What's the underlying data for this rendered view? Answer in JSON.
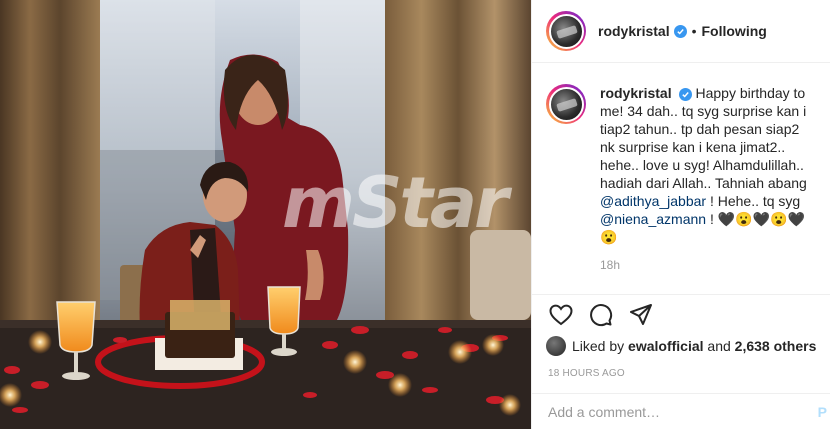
{
  "post": {
    "username": "rodykristal",
    "follow_status": "Following",
    "separator": "•",
    "photo_watermark": "mStar"
  },
  "caption": {
    "username": "rodykristal",
    "text_before_mention1": "Happy birthday to me! 34 dah.. tq syg surprise kan i tiap2 tahun.. tp dah pesan siap2 nk surprise kan i kena jimat2.. hehe.. love u syg! Alhamdulillah.. hadiah dari Allah.. Tahniah abang ",
    "mention1": "@adithya_jabbar",
    "text_between": " ! Hehe.. tq syg ",
    "mention2": "@niena_azmann",
    "text_after": " ! 🖤😮🖤😮🖤😮",
    "time_ago": "18h"
  },
  "actions": {
    "like_icon": "heart-icon",
    "comment_icon": "comment-bubble-icon",
    "share_icon": "paper-plane-icon"
  },
  "likes": {
    "prefix": "Liked by ",
    "user": "ewalofficial",
    "middle": " and ",
    "count": "2,638 others"
  },
  "date": "18 HOURS AGO",
  "add_comment": {
    "placeholder": "Add a comment…",
    "post_label": "P"
  },
  "colors": {
    "verified_blue": "#3897f0",
    "mention_blue": "#003569",
    "muted_gray": "#999999",
    "border": "#efefef"
  }
}
